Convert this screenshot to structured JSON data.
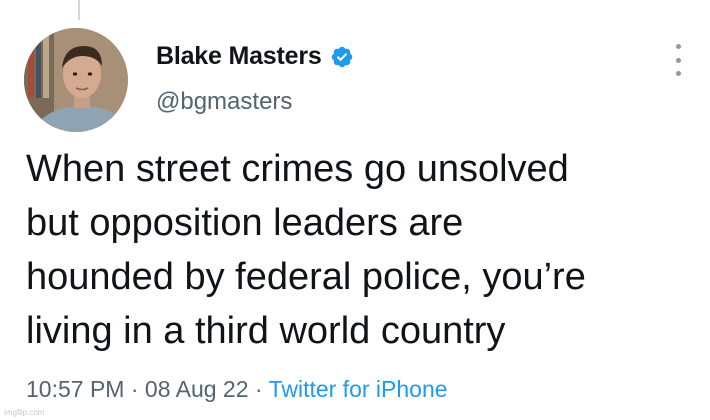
{
  "tweet": {
    "author": {
      "display_name": "Blake Masters",
      "handle": "@bgmasters",
      "verified": true,
      "avatar_icon": "profile-photo"
    },
    "text": "When street crimes go unsolved\nbut opposition leaders are\nhounded by federal police, you’re\nliving in a third world country",
    "time": "10:57 PM",
    "separator": "·",
    "date": "08 Aug 22",
    "source": "Twitter for iPhone"
  },
  "icons": {
    "verified": "verified-badge-icon",
    "more": "more-options-icon"
  },
  "colors": {
    "text": "#0f1419",
    "secondary": "#536471",
    "accent": "#1d9bf0"
  },
  "watermark": "imgflip.com"
}
